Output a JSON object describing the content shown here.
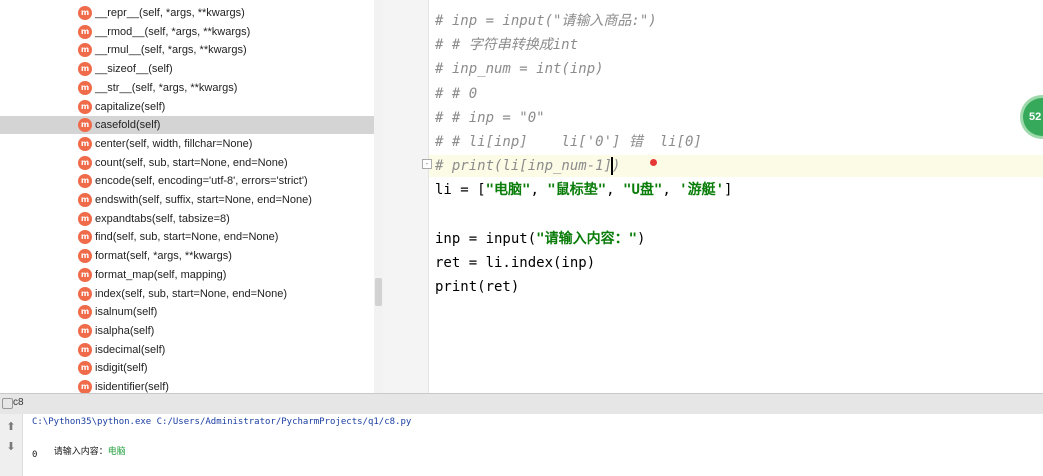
{
  "structure": {
    "methods": [
      {
        "badge": "m",
        "label": "__repr__(self, *args, **kwargs)"
      },
      {
        "badge": "m",
        "label": "__rmod__(self, *args, **kwargs)"
      },
      {
        "badge": "m",
        "label": "__rmul__(self, *args, **kwargs)"
      },
      {
        "badge": "m",
        "label": "__sizeof__(self)"
      },
      {
        "badge": "m",
        "label": "__str__(self, *args, **kwargs)"
      },
      {
        "badge": "m",
        "label": "capitalize(self)"
      },
      {
        "badge": "m",
        "label": "casefold(self)"
      },
      {
        "badge": "m",
        "label": "center(self, width, fillchar=None)"
      },
      {
        "badge": "m",
        "label": "count(self, sub, start=None, end=None)"
      },
      {
        "badge": "m",
        "label": "encode(self, encoding='utf-8', errors='strict')"
      },
      {
        "badge": "m",
        "label": "endswith(self, suffix, start=None, end=None)"
      },
      {
        "badge": "m",
        "label": "expandtabs(self, tabsize=8)"
      },
      {
        "badge": "m",
        "label": "find(self, sub, start=None, end=None)"
      },
      {
        "badge": "m",
        "label": "format(self, *args, **kwargs)"
      },
      {
        "badge": "m",
        "label": "format_map(self, mapping)"
      },
      {
        "badge": "m",
        "label": "index(self, sub, start=None, end=None)"
      },
      {
        "badge": "m",
        "label": "isalnum(self)"
      },
      {
        "badge": "m",
        "label": "isalpha(self)"
      },
      {
        "badge": "m",
        "label": "isdecimal(self)"
      },
      {
        "badge": "m",
        "label": "isdigit(self)"
      },
      {
        "badge": "m",
        "label": "isidentifier(self)"
      }
    ],
    "selected": "casefold(self)"
  },
  "editor": {
    "lines": [
      {
        "text": "# inp = input(\"请输入商品:\")",
        "kind": "comment"
      },
      {
        "text": "# # 字符串转换成int",
        "kind": "comment"
      },
      {
        "text": "# inp_num = int(inp)",
        "kind": "comment"
      },
      {
        "text": "# # 0",
        "kind": "comment"
      },
      {
        "text": "# # inp = \"0\"",
        "kind": "comment"
      },
      {
        "text": "# # li[inp]    li['0'] 错  li[0]",
        "kind": "comment"
      },
      {
        "text": "# print(li[inp_num-1])",
        "kind": "comment"
      },
      {
        "text": "li = [",
        "kind": "code"
      },
      {
        "text": "",
        "kind": "blank"
      },
      {
        "text": "inp = input(",
        "kind": "code"
      },
      {
        "text": "ret = li.index(inp)",
        "kind": "code"
      },
      {
        "text": "print(ret)",
        "kind": "code"
      }
    ],
    "li_items": [
      "\"电脑\"",
      "\"鼠标垫\"",
      "\"U盘\"",
      "'游艇'"
    ],
    "li_tail": "]",
    "input_prompt": "\"请输入内容：\"",
    "input_tail": ")"
  },
  "floating_badge": "52",
  "run_panel": {
    "tab_label": "c8",
    "command": "C:\\Python35\\python.exe C:/Users/Administrator/PycharmProjects/q1/c8.py",
    "prompt": "请输入内容：",
    "typed_value": "电脑",
    "output": "0"
  },
  "colors": {
    "method_badge": "#f06b4a",
    "comment": "#8c8c8c",
    "string": "#0a7d0a",
    "selected_row": "#d4d4d4",
    "console_input": "#1f9d3a"
  }
}
